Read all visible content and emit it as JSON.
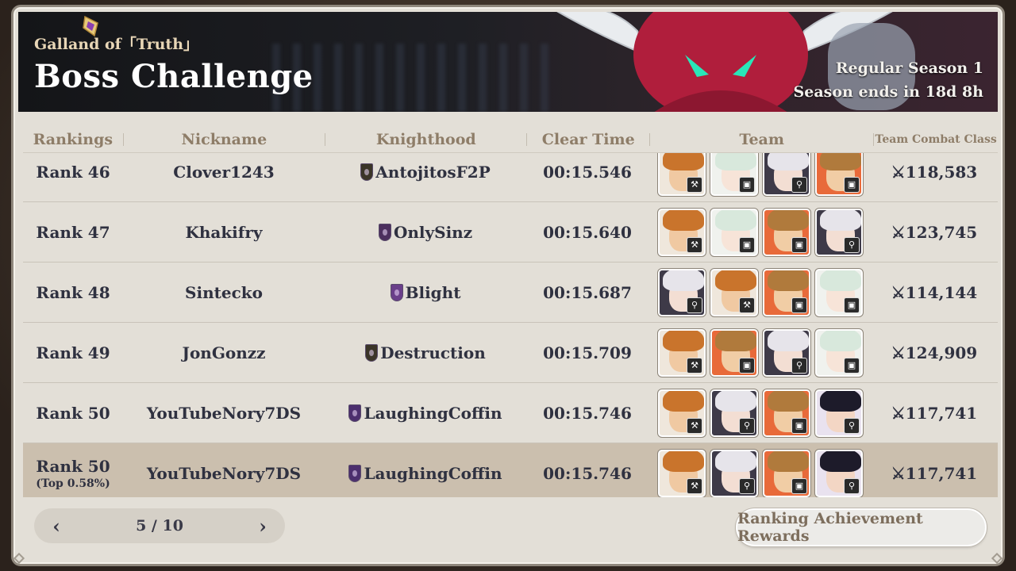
{
  "header": {
    "subtitle": "Galland of「Truth」",
    "title": "Boss Challenge",
    "season": "Regular Season 1",
    "season_ends": "Season ends in 18d 8h"
  },
  "columns": {
    "rankings": "Rankings",
    "nickname": "Nickname",
    "knighthood": "Knighthood",
    "clear_time": "Clear Time",
    "team": "Team",
    "team_combat_class": "Team Combat Class"
  },
  "rows": [
    {
      "rank": "Rank 46",
      "nickname": "Clover1243",
      "knighthood": "AntojitosF2P",
      "emblem_color": "#3b3528",
      "time": "00:15.546",
      "team": [
        "escanor-icon",
        "elizabeth-icon",
        "elaine-icon",
        "goggles-icon"
      ],
      "power": "118,583"
    },
    {
      "rank": "Rank 47",
      "nickname": "Khakifry",
      "knighthood": "OnlySinz",
      "emblem_color": "#4c2f5e",
      "time": "00:15.640",
      "team": [
        "escanor-icon",
        "elizabeth-icon",
        "goggles-icon",
        "elaine-icon"
      ],
      "power": "123,745"
    },
    {
      "rank": "Rank 48",
      "nickname": "Sintecko",
      "knighthood": "Blight",
      "emblem_color": "#6a3f8a",
      "time": "00:15.687",
      "team": [
        "elaine-icon",
        "escanor-icon",
        "goggles-icon",
        "elizabeth-icon"
      ],
      "power": "114,144"
    },
    {
      "rank": "Rank 49",
      "nickname": "JonGonzz",
      "knighthood": "Destruction",
      "emblem_color": "#3b3528",
      "time": "00:15.709",
      "team": [
        "escanor-icon",
        "goggles-icon",
        "elaine-icon",
        "elizabeth-icon"
      ],
      "power": "124,909"
    },
    {
      "rank": "Rank 50",
      "nickname": "YouTubeNory7DS",
      "knighthood": "LaughingCoffin",
      "emblem_color": "#4c2f6e",
      "time": "00:15.746",
      "team": [
        "escanor-icon",
        "elaine-icon",
        "goggles-icon",
        "merlin-icon"
      ],
      "power": "117,741"
    }
  ],
  "my_row": {
    "rank": "Rank 50",
    "percentile": "(Top 0.58%)",
    "nickname": "YouTubeNory7DS",
    "knighthood": "LaughingCoffin",
    "emblem_color": "#4c2f6e",
    "time": "00:15.746",
    "team": [
      "escanor-icon",
      "elaine-icon",
      "goggles-icon",
      "merlin-icon"
    ],
    "power": "117,741"
  },
  "pagination": {
    "page": "5 / 10",
    "prev_icon": "chevron-left-icon",
    "next_icon": "chevron-right-icon"
  },
  "rewards_button": "Ranking Achievement Rewards",
  "power_prefix": "⚔",
  "characters": {
    "escanor-icon": {
      "hair": "#c9742c",
      "skin": "#f0c9a2",
      "bg": "#efe7dc",
      "badge": "⚒"
    },
    "elizabeth-icon": {
      "hair": "#d8e8dc",
      "skin": "#f7e4d8",
      "bg": "#f0f2ee",
      "badge": "▣"
    },
    "elaine-icon": {
      "hair": "#e6e4ea",
      "skin": "#f3ded3",
      "bg": "#3e3a48",
      "badge": "⚲"
    },
    "goggles-icon": {
      "hair": "#b07a3c",
      "skin": "#f1cda5",
      "bg": "#e86a3a",
      "badge": "▣"
    },
    "merlin-icon": {
      "hair": "#1d1b2a",
      "skin": "#f3d6c4",
      "bg": "#e9e2ef",
      "badge": "⚲"
    }
  }
}
